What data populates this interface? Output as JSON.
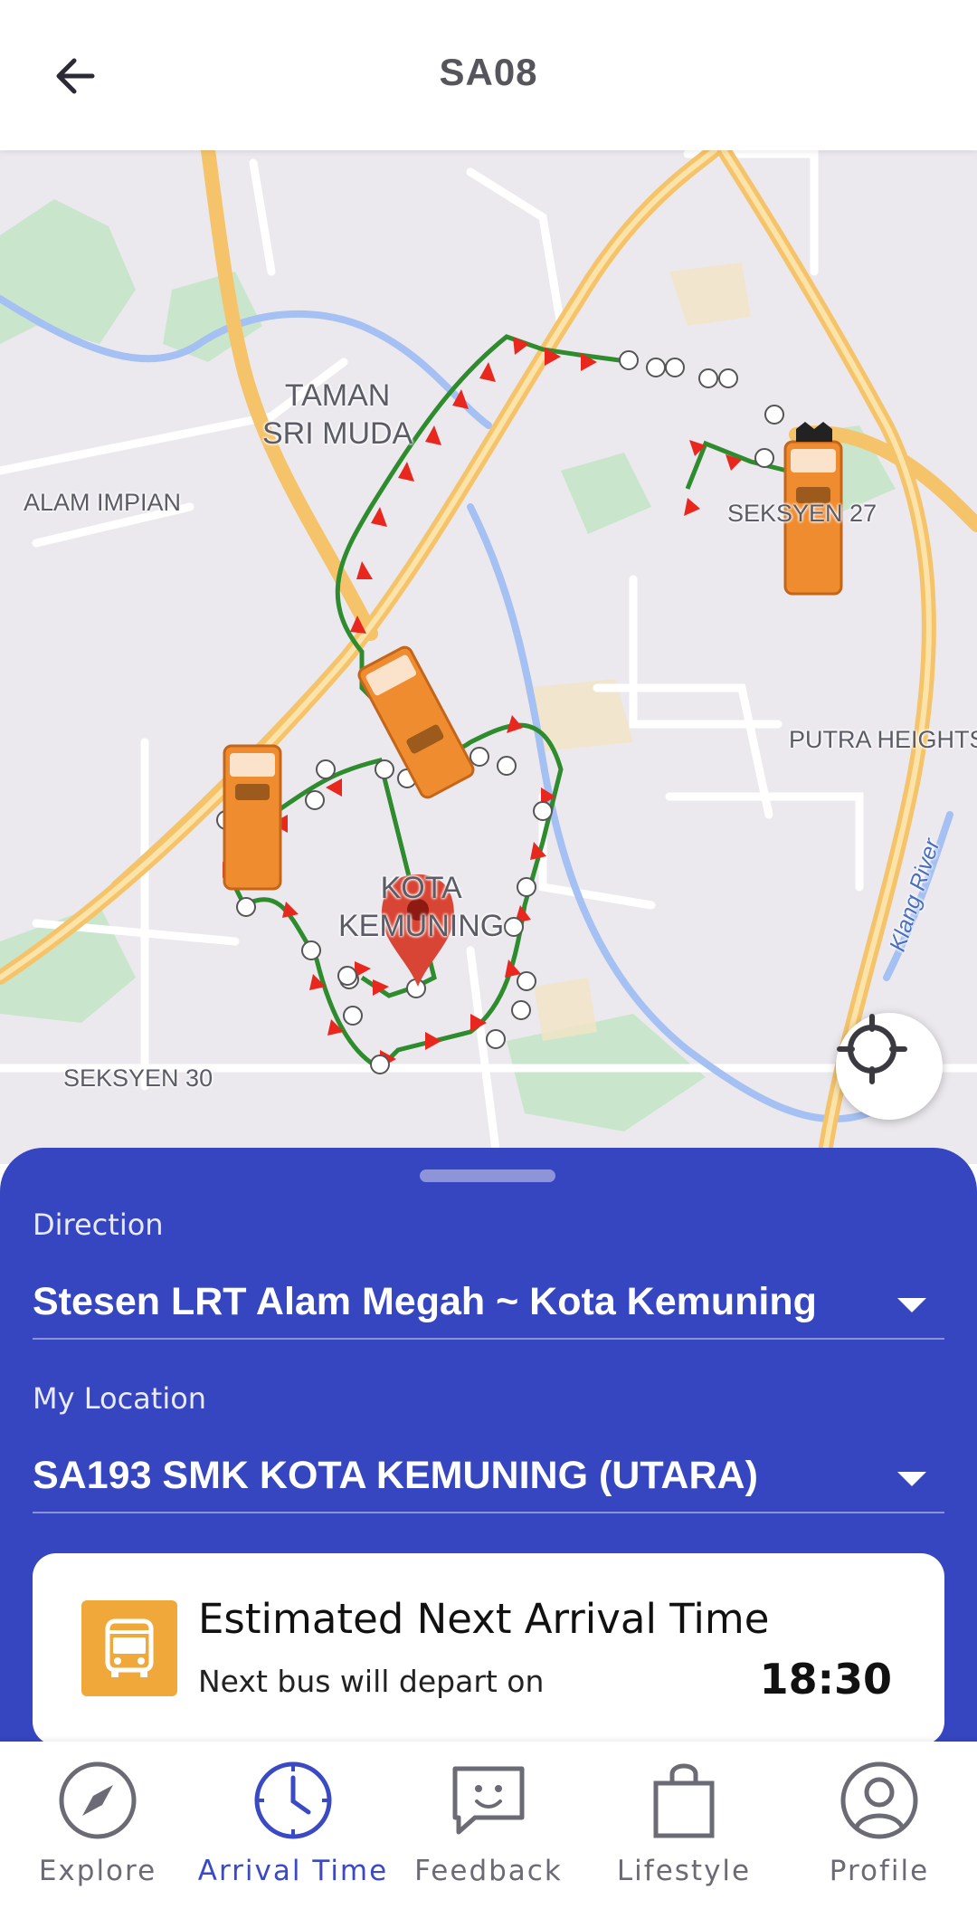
{
  "header": {
    "title": "SA08"
  },
  "map": {
    "labels": {
      "taman_sri_muda": "TAMAN\nSRI MUDA",
      "alam_impian": "ALAM IMPIAN",
      "seksyen_27": "SEKSYEN 27",
      "putra_heights": "PUTRA HEIGHTS",
      "kota_kemuning": "KOTA\nKEMUNING",
      "seksyen_30": "SEKSYEN 30",
      "klang_river": "Klang River"
    },
    "colors": {
      "route_line": "#2e8b2e",
      "route_arrow": "#e8281e",
      "bus": "#f08c30",
      "road_major": "#f5c36a",
      "water": "#9ab8f0",
      "park": "#c4e3c8"
    }
  },
  "sheet": {
    "direction_label": "Direction",
    "direction_value": "Stesen LRT Alam Megah ~ Kota Kemuning",
    "location_label": "My Location",
    "location_value": "SA193 SMK KOTA KEMUNING (UTARA)",
    "card": {
      "title": "Estimated Next Arrival Time",
      "subtitle": "Next bus will depart on",
      "time": "18:30"
    }
  },
  "nav": {
    "items": [
      {
        "label": "Explore",
        "icon": "compass-icon"
      },
      {
        "label": "Arrival Time",
        "icon": "clock-icon",
        "active": true
      },
      {
        "label": "Feedback",
        "icon": "feedback-icon"
      },
      {
        "label": "Lifestyle",
        "icon": "shopping-bag-icon"
      },
      {
        "label": "Profile",
        "icon": "profile-icon"
      }
    ],
    "active_color": "#3a49c4",
    "inactive_color": "#6b6b75"
  },
  "theme": {
    "primary": "#3645c0",
    "bus_tile": "#f0a83b"
  }
}
